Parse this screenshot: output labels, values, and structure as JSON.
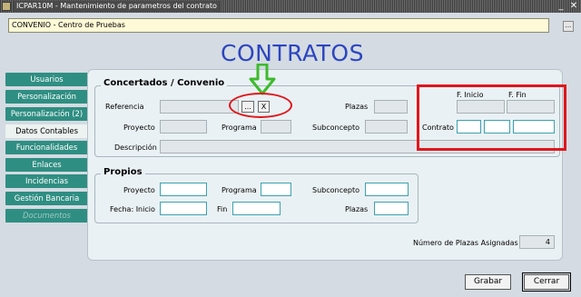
{
  "window": {
    "title": "ICPAR10M - Mantenimiento de parametros del contrato",
    "min_glyph": "_",
    "max_glyph": "↗",
    "close_glyph": "✕"
  },
  "header": {
    "convenio_value": "CONVENIO - Centro de Pruebas",
    "ellipsis_label": "..."
  },
  "page_title": "CONTRATOS",
  "tabs": [
    {
      "label": "Usuarios"
    },
    {
      "label": "Personalización"
    },
    {
      "label": "Personalización (2)"
    },
    {
      "label": "Datos Contables"
    },
    {
      "label": "Funcionalidades"
    },
    {
      "label": "Enlaces"
    },
    {
      "label": "Incidencias"
    },
    {
      "label": "Gestión Bancaria"
    },
    {
      "label": "Documentos"
    }
  ],
  "concertados": {
    "title": "Concertados / Convenio",
    "referencia_label": "Referencia",
    "ellipsis_label": "...",
    "clear_label": "X",
    "plazas_label": "Plazas",
    "proyecto_label": "Proyecto",
    "programa_label": "Programa",
    "subconcepto_label": "Subconcepto",
    "descripcion_label": "Descripción",
    "f_inicio_label": "F. Inicio",
    "f_fin_label": "F. Fin",
    "contrato_label": "Contrato"
  },
  "propios": {
    "title": "Propios",
    "proyecto_label": "Proyecto",
    "programa_label": "Programa",
    "subconcepto_label": "Subconcepto",
    "fecha_inicio_label": "Fecha: Inicio",
    "fin_label": "Fin",
    "plazas_label": "Plazas"
  },
  "num_plazas": {
    "label": "Número de Plazas Asignadas",
    "value": "4"
  },
  "buttons": {
    "grabar": "Grabar",
    "cerrar": "Cerrar"
  },
  "colors": {
    "title_blue": "#2c45c0",
    "annotation_red": "#e0161c",
    "annotation_green": "#3dbb2c",
    "tab_teal": "#2f8e82"
  }
}
